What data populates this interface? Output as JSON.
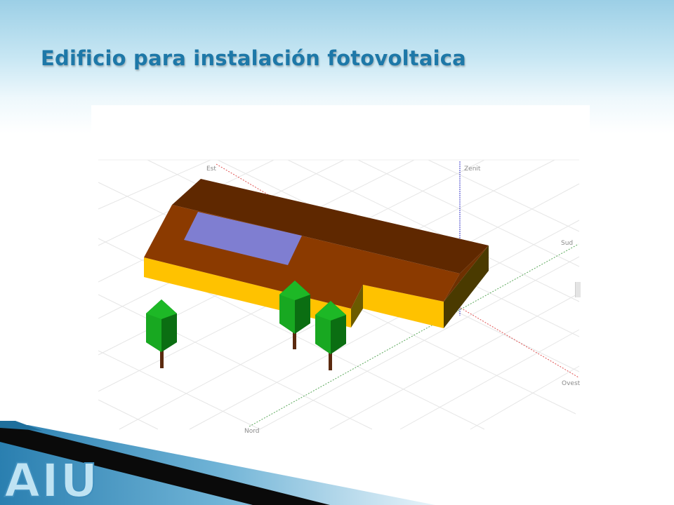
{
  "slide": {
    "title": "Edificio para instalación fotovoltaica"
  },
  "scene": {
    "axes": {
      "east": "Est",
      "zenith": "Zenit",
      "south": "Sud",
      "west": "Ovest",
      "north": "Nord"
    },
    "colors": {
      "roof_top": "#5f2800",
      "roof_front": "#8b3a00",
      "wall_front": "#ffc200",
      "panel": "#7f7ed1",
      "tree_light": "#129b1b",
      "tree_dark": "#0b6e12",
      "trunk": "#5b2a0f"
    }
  },
  "logo": {
    "text": "AIU"
  }
}
